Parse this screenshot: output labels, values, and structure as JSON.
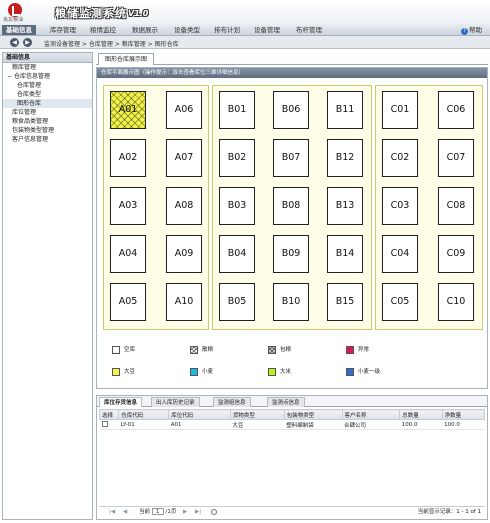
{
  "header": {
    "company": "良友粮油",
    "title": "粮储监测系统",
    "version": "V1.0"
  },
  "menu": {
    "items": [
      "基础信息",
      "库存管理",
      "粮情监控",
      "数据展示",
      "设备类型",
      "排布计划",
      "设备管理",
      "布杆管理"
    ],
    "active_index": 0,
    "help": "帮助"
  },
  "breadcrumb": {
    "prefix": "监测设备管理",
    "path": [
      "仓库管理",
      "粮库管理",
      "图形仓库"
    ]
  },
  "sidebar": {
    "title": "基础信息",
    "items": [
      {
        "label": "粮库管理",
        "indent": 1,
        "toggle": ""
      },
      {
        "label": "仓库信息管理",
        "indent": 0,
        "toggle": "−"
      },
      {
        "label": "仓库管理",
        "indent": 2,
        "toggle": ""
      },
      {
        "label": "仓库类型",
        "indent": 2,
        "toggle": ""
      },
      {
        "label": "图形仓库",
        "indent": 2,
        "toggle": ""
      },
      {
        "label": "库位管理",
        "indent": 1,
        "toggle": ""
      },
      {
        "label": "粮食品类管理",
        "indent": 1,
        "toggle": ""
      },
      {
        "label": "包装物类型管理",
        "indent": 1,
        "toggle": ""
      },
      {
        "label": "客户信息管理",
        "indent": 1,
        "toggle": ""
      }
    ]
  },
  "main": {
    "tab": "图形仓库展示图",
    "panel_title": "仓库平面展示图（操作提示：双击查看库位三维详细信息）"
  },
  "warehouses": [
    {
      "columns": [
        [
          "A01",
          "A02",
          "A03",
          "A04",
          "A05"
        ],
        [
          "A06",
          "A07",
          "A08",
          "A09",
          "A10"
        ]
      ]
    },
    {
      "columns": [
        [
          "B01",
          "B02",
          "B03",
          "B04",
          "B05"
        ],
        [
          "B06",
          "B07",
          "B08",
          "B09",
          "B10"
        ],
        [
          "B11",
          "B12",
          "B13",
          "B14",
          "B15"
        ]
      ]
    },
    {
      "columns": [
        [
          "C01",
          "C02",
          "C03",
          "C04",
          "C05"
        ],
        [
          "C06",
          "C07",
          "C08",
          "C09",
          "C10"
        ]
      ]
    }
  ],
  "filled_slots": [
    "A01"
  ],
  "legend": [
    {
      "label": "空库",
      "color": "#ffffff",
      "hatch": false
    },
    {
      "label": "散粮",
      "color": "#ffffff",
      "hatch": true
    },
    {
      "label": "包粮",
      "color": "#d0d0d0",
      "hatch": true
    },
    {
      "label": "异常",
      "color": "#e0155c",
      "hatch": false
    },
    {
      "label": "大豆",
      "color": "#f4f250",
      "hatch": false
    },
    {
      "label": "小麦",
      "color": "#19b9e8",
      "hatch": false
    },
    {
      "label": "大米",
      "color": "#c2f21a",
      "hatch": false
    },
    {
      "label": "小麦一级",
      "color": "#2d6fd0",
      "hatch": false
    }
  ],
  "bottom": {
    "tabs": [
      "库位存货信息",
      "出入库历史记录",
      "监测组信息",
      "监测点信息"
    ],
    "active_tab": 0,
    "columns": [
      "选择",
      "仓库代码",
      "库位代码",
      "货物类型",
      "包装物类型",
      "客户名称",
      "总数量",
      "净数量"
    ],
    "rows": [
      [
        "",
        "LY-01",
        "A01",
        "大豆",
        "塑料编制袋",
        "合肆公司",
        "100.0",
        "100.0"
      ]
    ],
    "pager": {
      "page_prefix": "当前",
      "page_value": "1",
      "page_suffix": "/1页",
      "summary": "当前显示记录：1 - 1 of 1"
    }
  }
}
